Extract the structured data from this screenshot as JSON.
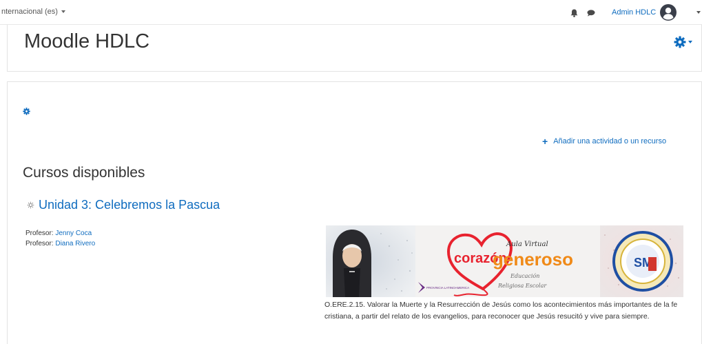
{
  "topbar": {
    "language": "nternacional (es)",
    "user_name": "Admin HDLC",
    "icons": {
      "notifications": "bell-icon",
      "messages": "chat-icon",
      "user": "avatar-icon"
    }
  },
  "header": {
    "site_title": "Moodle HDLC",
    "settings_icon": "gear-icon"
  },
  "main": {
    "add_activity_label": "Añadir una actividad o un recurso",
    "section_title": "Cursos disponibles",
    "course": {
      "name": "Unidad 3: Celebremos la Pascua",
      "teachers": [
        {
          "role": "Profesor:",
          "name": "Jenny Coca"
        },
        {
          "role": "Profesor:",
          "name": "Diana Rivero"
        }
      ],
      "banner": {
        "heart_text": "corazón",
        "aula_text": "Aula Virtual",
        "generoso_text": "generoso",
        "script_text_1": "Educación",
        "script_text_2": "Religiosa Escolar",
        "small_text": "PROVINCIA LATINOAMERICA",
        "seal_initials": "SM"
      },
      "summary": "O.ERE.2.15. Valorar la Muerte y la Resurrección de Jesús como los acontecimientos más importantes de la fe cristiana, a partir del relato de los evangelios, para reconocer que Jesús resucitó y vive para siempre."
    }
  },
  "colors": {
    "link": "#0f6cbf",
    "heart": "#e8232f",
    "generoso": "#f08a18"
  }
}
